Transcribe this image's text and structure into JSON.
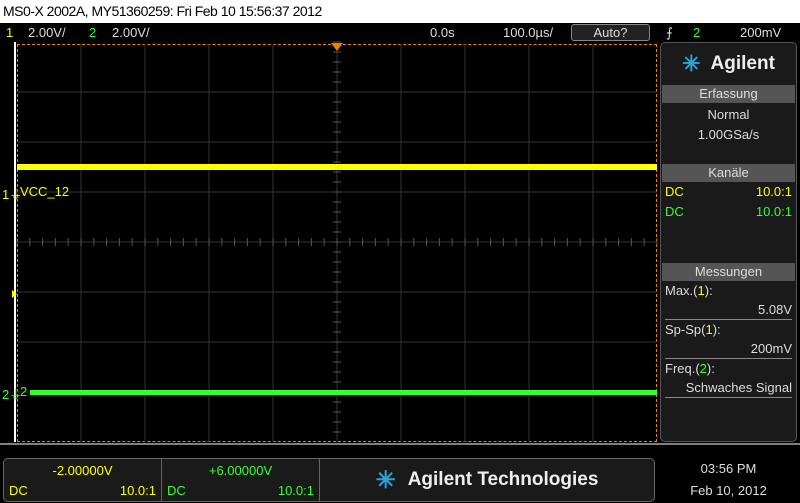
{
  "title": "MS0-X 2002A, MY51360259: Fri Feb 10 15:56:37 2012",
  "top": {
    "ch1_num": "1",
    "ch1_scale": "2.00V/",
    "ch2_num": "2",
    "ch2_scale": "2.00V/",
    "delay": "0.0s",
    "timebase": "100.0µs/",
    "auto_button": "Auto?",
    "trigger_source": "2",
    "trigger_level": "200mV"
  },
  "colors": {
    "ch1": "#ffff00",
    "ch2": "#33ff33",
    "trigger": "#f08000",
    "accent": "#29a3d6"
  },
  "traces": {
    "ch1_label": "VCC_12",
    "ch1_marker": "1",
    "ch2_label": "2",
    "ch2_marker": "2",
    "ch1_level_div": 5.5,
    "ch2_level_div": 1.0
  },
  "side": {
    "logo": "Agilent",
    "acq_header": "Erfassung",
    "acq_mode": "Normal",
    "acq_rate": "1.00GSa/s",
    "chan_header": "Kanäle",
    "channels": [
      {
        "coupling": "DC",
        "probe": "10.0:1"
      },
      {
        "coupling": "DC",
        "probe": "10.0:1"
      }
    ],
    "meas_header": "Messungen",
    "measurements": [
      {
        "name": "Max.(",
        "ch": "1",
        "close": "):",
        "value": "5.08V"
      },
      {
        "name": "Sp-Sp(",
        "ch": "1",
        "close": "):",
        "value": "200mV"
      },
      {
        "name": "Freq.(",
        "ch": "2",
        "close": "):",
        "value": "Schwaches Signal"
      }
    ]
  },
  "bottom": {
    "ch1": {
      "offset": "-2.00000V",
      "coupling": "DC",
      "probe": "10.0:1"
    },
    "ch2": {
      "offset": "+6.00000V",
      "coupling": "DC",
      "probe": "10.0:1"
    },
    "brand": "Agilent Technologies"
  },
  "clock": {
    "time": "03:56 PM",
    "date": "Feb 10, 2012"
  }
}
